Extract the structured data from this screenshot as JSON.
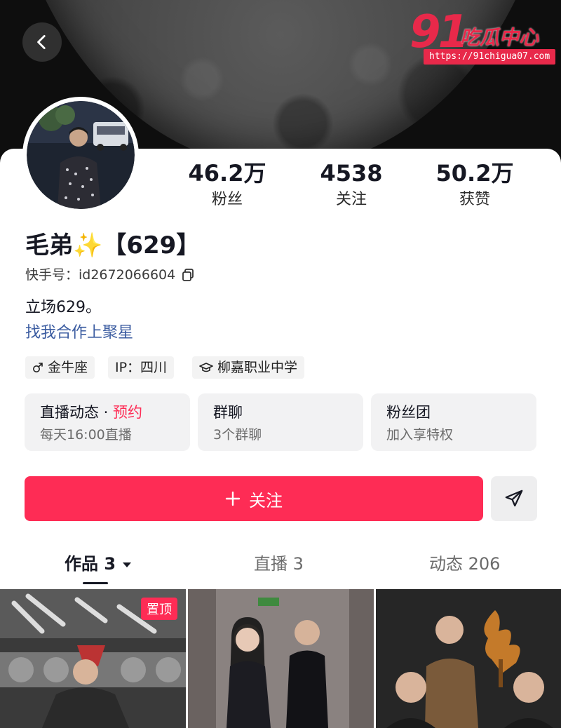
{
  "header": {
    "back_icon": "chevron-left-icon",
    "watermark": {
      "number": "91",
      "name": "吃瓜中心",
      "url": "https://91chigua07.com"
    }
  },
  "profile": {
    "name": "毛弟✨【629】",
    "uid_label": "快手号：id2672066604",
    "bio": "立场629。",
    "collab_link": "找我合作上聚星",
    "stats": [
      {
        "value": "46.2万",
        "label": "粉丝"
      },
      {
        "value": "4538",
        "label": "关注"
      },
      {
        "value": "50.2万",
        "label": "获赞"
      }
    ],
    "tags": [
      {
        "icon": "male-icon",
        "label": "金牛座"
      },
      {
        "icon": "",
        "label": "IP：四川"
      },
      {
        "icon": "graduation-cap-icon",
        "label": "柳嘉职业中学"
      }
    ]
  },
  "cards": [
    {
      "title": "直播动态 · ",
      "accent": "预约",
      "sub": "每天16:00直播"
    },
    {
      "title": "群聊",
      "accent": "",
      "sub": "3个群聊"
    },
    {
      "title": "粉丝团",
      "accent": "",
      "sub": "加入享特权"
    }
  ],
  "actions": {
    "follow_label": "关注",
    "share_icon": "send-icon"
  },
  "tabs": [
    {
      "label": "作品 3",
      "active": true
    },
    {
      "label": "直播 3",
      "active": false
    },
    {
      "label": "动态 206",
      "active": false
    }
  ],
  "grid": {
    "pinned_label": "置顶"
  },
  "colors": {
    "accent": "#fe2c55",
    "link": "#3a5ba0"
  }
}
